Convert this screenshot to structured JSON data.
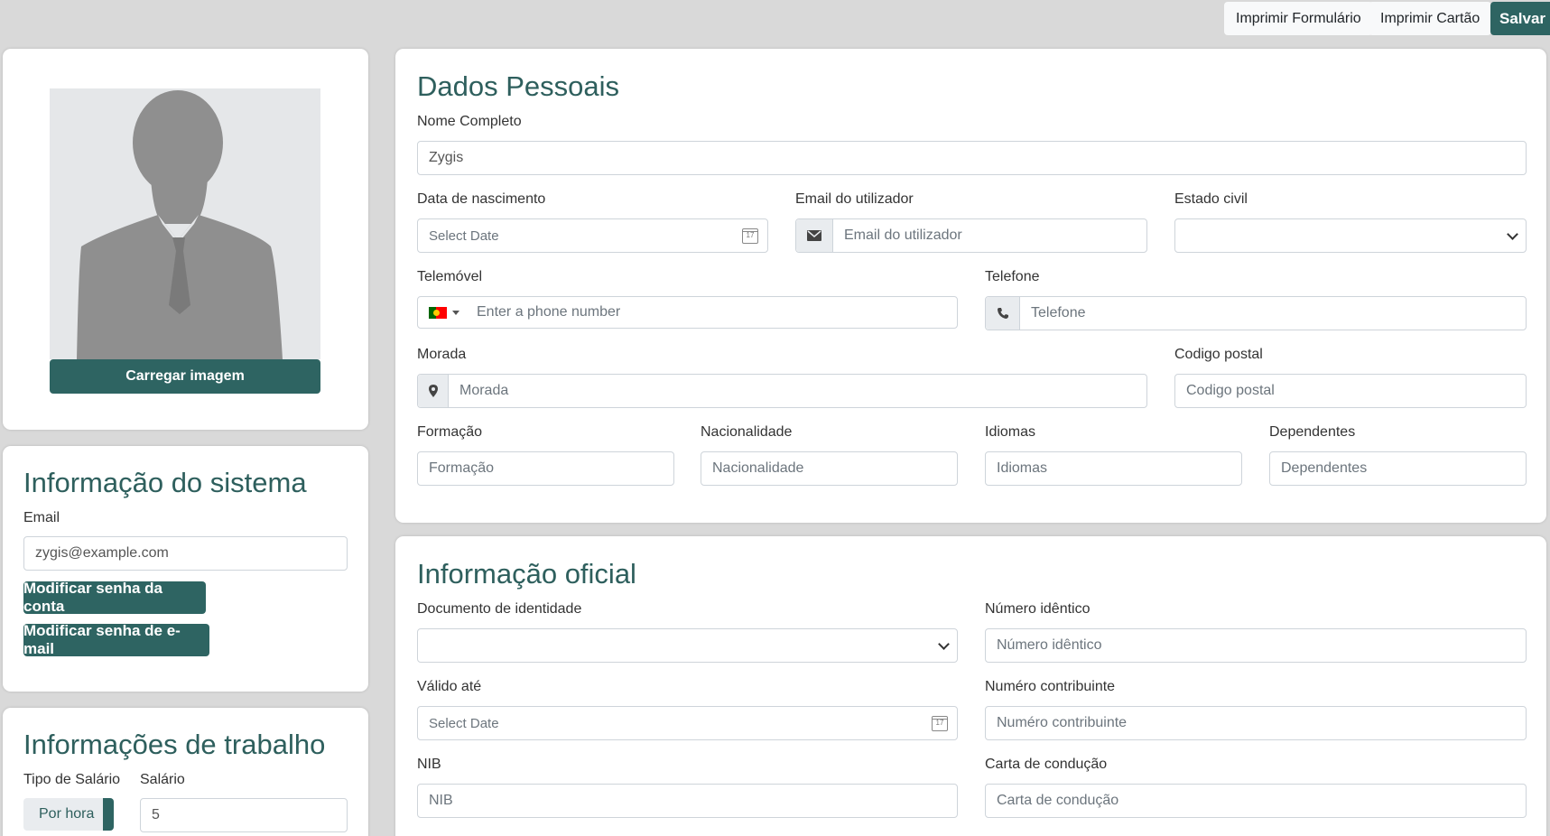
{
  "toolbar": {
    "print_form": "Imprimir Formulário",
    "print_card": "Imprimir Cartão",
    "save": "Salvar"
  },
  "photo": {
    "upload_label": "Carregar imagem"
  },
  "system": {
    "title": "Informação do sistema",
    "email_label": "Email",
    "email_value": "zygis@example.com",
    "change_account_password": "Modificar senha da conta",
    "change_email_password": "Modificar senha de e-mail"
  },
  "work": {
    "title": "Informações de trabalho",
    "salary_type_label": "Tipo de Salário",
    "salary_type_value": "Por hora",
    "salary_label": "Salário",
    "salary_value": "5"
  },
  "personal": {
    "title": "Dados Pessoais",
    "full_name_label": "Nome Completo",
    "full_name_value": "Zygis",
    "birth_label": "Data de nascimento",
    "birth_placeholder": "Select Date",
    "user_email_label": "Email do utilizador",
    "user_email_placeholder": "Email do utilizador",
    "civil_label": "Estado civil",
    "mobile_label": "Telemóvel",
    "mobile_placeholder": "Enter a phone number",
    "phone_label": "Telefone",
    "phone_placeholder": "Telefone",
    "address_label": "Morada",
    "address_placeholder": "Morada",
    "postal_label": "Codigo postal",
    "postal_placeholder": "Codigo postal",
    "education_label": "Formação",
    "education_placeholder": "Formação",
    "nationality_label": "Nacionalidade",
    "nationality_placeholder": "Nacionalidade",
    "languages_label": "Idiomas",
    "languages_placeholder": "Idiomas",
    "dependents_label": "Dependentes",
    "dependents_placeholder": "Dependentes"
  },
  "official": {
    "title": "Informação oficial",
    "id_doc_label": "Documento de identidade",
    "id_number_label": "Número idêntico",
    "id_number_placeholder": "Número idêntico",
    "valid_label": "Válido até",
    "valid_placeholder": "Select Date",
    "tax_label": "Numéro contribuinte",
    "tax_placeholder": "Numéro contribuinte",
    "nib_label": "NIB",
    "nib_placeholder": "NIB",
    "license_label": "Carta de condução",
    "license_placeholder": "Carta de condução"
  },
  "colors": {
    "accent": "#2e6462",
    "title": "#2e5f5d",
    "background": "#d9d9d9"
  }
}
